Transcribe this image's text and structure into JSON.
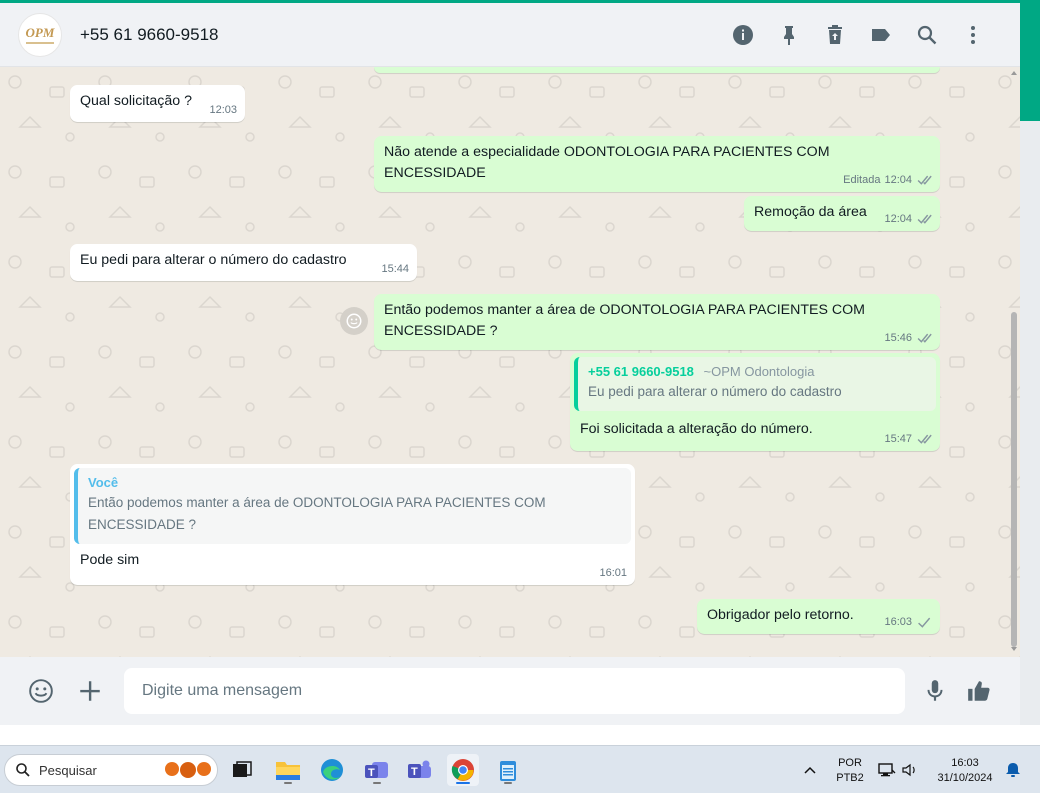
{
  "header": {
    "avatar_text": "OPM",
    "contact": "+55 61 9660-9518",
    "icons": [
      "info-icon",
      "pin-icon",
      "delete-icon",
      "label-icon",
      "search-icon",
      "menu-icon"
    ]
  },
  "messages": [
    {
      "dir": "in",
      "text": "Qual solicitação ?",
      "time": "12:03"
    },
    {
      "dir": "out",
      "text": "Não atende a especialidade ODONTOLOGIA PARA PACIENTES COM ENCESSIDADE",
      "edited": "Editada",
      "time": "12:04"
    },
    {
      "dir": "out",
      "text": "Remoção da área",
      "time": "12:04"
    },
    {
      "dir": "in",
      "text": "Eu pedi para alterar o número do cadastro",
      "time": "15:44"
    },
    {
      "dir": "out",
      "text": "Então podemos manter a área de ODONTOLOGIA PARA PACIENTES COM ENCESSIDADE ?",
      "time": "15:46"
    },
    {
      "dir": "out",
      "quote_author": "+55 61 9660-9518",
      "quote_alias": "~OPM Odontologia",
      "quote_text": "Eu pedi para alterar o número do cadastro",
      "text": "Foi solicitada a alteração do número.",
      "time": "15:47"
    },
    {
      "dir": "in",
      "quote_author": "Você",
      "quote_text": "Então podemos manter a área de ODONTOLOGIA PARA PACIENTES COM ENCESSIDADE ?",
      "text": "Pode sim",
      "time": "16:01"
    },
    {
      "dir": "out",
      "text": "Obrigador pelo retorno.",
      "time": "16:03"
    }
  ],
  "composer": {
    "placeholder": "Digite uma mensagem"
  },
  "taskbar": {
    "search_label": "Pesquisar",
    "lang_line1": "POR",
    "lang_line2": "PTB2",
    "time": "16:03",
    "date": "31/10/2024"
  }
}
